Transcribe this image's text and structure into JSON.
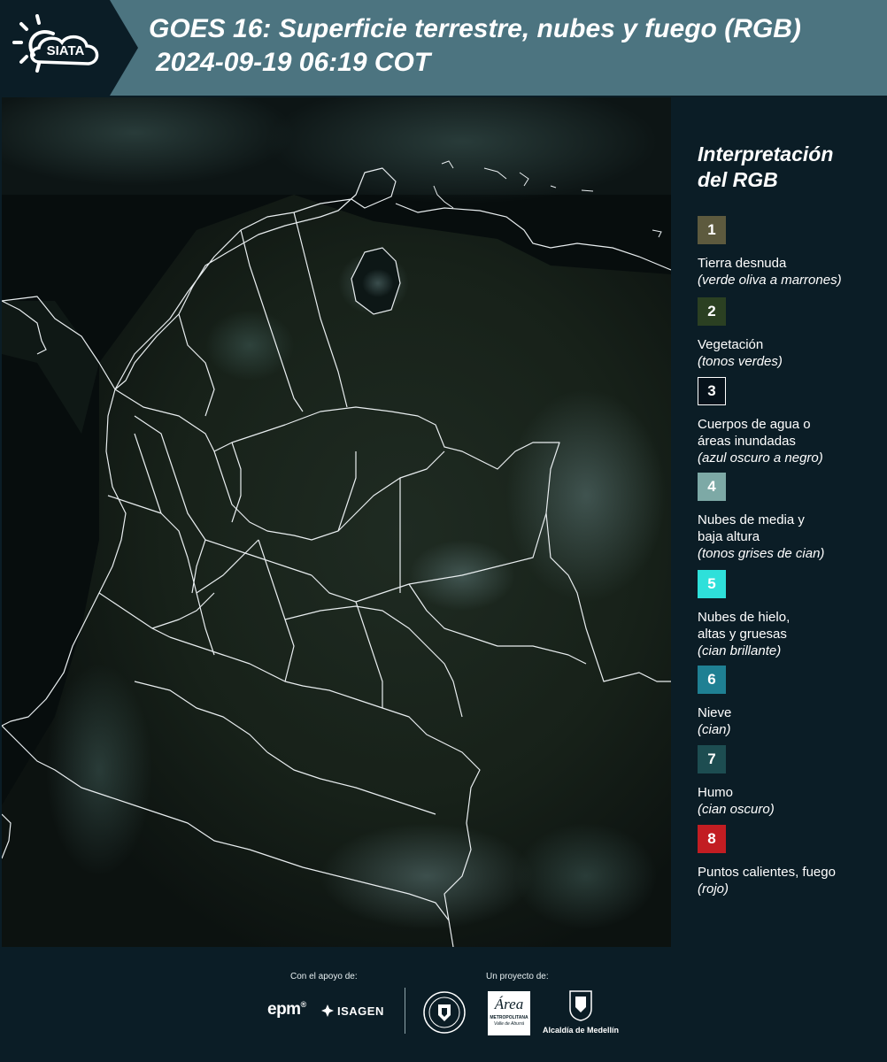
{
  "header": {
    "logo_text": "SIATA",
    "title_line1": "GOES 16: Superficie terrestre, nubes y fuego (RGB)",
    "title_line2": "2024-09-19 06:19 COT",
    "bg_color": "#4c7480"
  },
  "legend": {
    "title_line1": "Interpretación",
    "title_line2": "del RGB",
    "items": [
      {
        "num": "1",
        "label": "Tierra desnuda",
        "sub": "(verde oliva a marrones)",
        "color": "#5d5a3e"
      },
      {
        "num": "2",
        "label": "Vegetación",
        "sub": "(tonos verdes)",
        "color": "#2b4022"
      },
      {
        "num": "3",
        "label_line1": "Cuerpos de agua o",
        "label_line2": "áreas inundadas",
        "sub": "(azul oscuro a negro)",
        "color": "#06121b"
      },
      {
        "num": "4",
        "label_line1": "Nubes de media y",
        "label_line2": "baja altura",
        "sub": "(tonos grises de cian)",
        "color": "#7da9a6"
      },
      {
        "num": "5",
        "label_line1": "Nubes de hielo,",
        "label_line2": "altas y gruesas",
        "sub": "(cian brillante)",
        "color": "#2ee0da"
      },
      {
        "num": "6",
        "label": "Nieve",
        "sub": "(cian)",
        "color": "#1f8093"
      },
      {
        "num": "7",
        "label": "Humo",
        "sub": "(cian oscuro)",
        "color": "#1d4d51"
      },
      {
        "num": "8",
        "label": "Puntos calientes, fuego",
        "sub": "(rojo)",
        "color": "#c21d22"
      }
    ]
  },
  "footer": {
    "support_label": "Con el apoyo de:",
    "project_label": "Un proyecto de:",
    "epm": "epm",
    "isagen": "ISAGEN",
    "area_logo": "Área",
    "area_line1": "METROPOLITANA",
    "area_line2": "Valle de Aburrá",
    "alcaldia": "Alcaldía de Medellín"
  }
}
